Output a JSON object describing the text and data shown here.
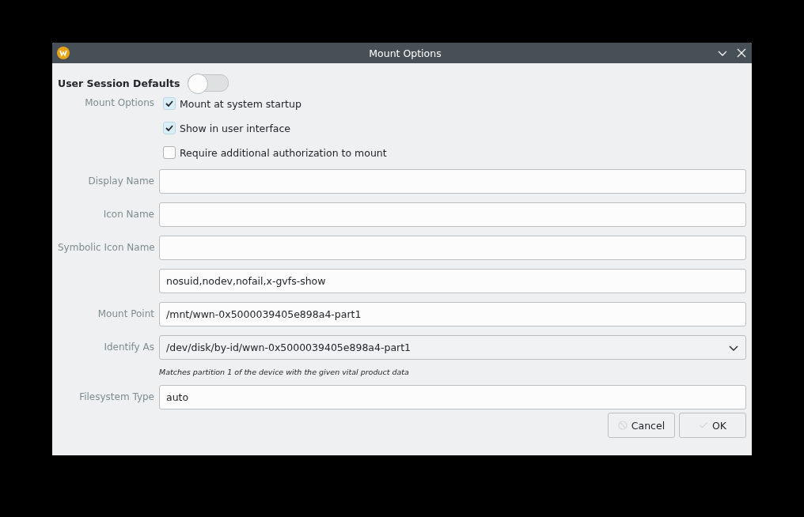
{
  "window": {
    "title": "Mount Options"
  },
  "session_defaults": {
    "label": "User Session Defaults",
    "on": false
  },
  "mount_options": {
    "label": "Mount Options",
    "checkboxes": [
      {
        "label": "Mount at system startup",
        "checked": true
      },
      {
        "label": "Show in user interface",
        "checked": true
      },
      {
        "label": "Require additional authorization to mount",
        "checked": false
      }
    ]
  },
  "fields": [
    {
      "kind": "text",
      "label": "Display Name"
    },
    {
      "kind": "text",
      "label": "Icon Name"
    },
    {
      "kind": "text",
      "label": "Symbolic Icon Name"
    },
    {
      "kind": "text",
      "value": "nosuid,nodev,nofail,x-gvfs-show"
    },
    {
      "kind": "text",
      "label": "Mount Point",
      "value": "/mnt/wwn-0x5000039405e898a4-part1"
    },
    {
      "kind": "combo",
      "label": "Identify As",
      "value": "/dev/disk/by-id/wwn-0x5000039405e898a4-part1",
      "hint": "Matches partition 1 of the device with the given vital product data"
    },
    {
      "kind": "text",
      "label": "Filesystem Type",
      "value": "auto"
    }
  ],
  "buttons": [
    {
      "label": "Cancel",
      "kind": "cancel"
    },
    {
      "label": "OK",
      "kind": "ok"
    }
  ]
}
